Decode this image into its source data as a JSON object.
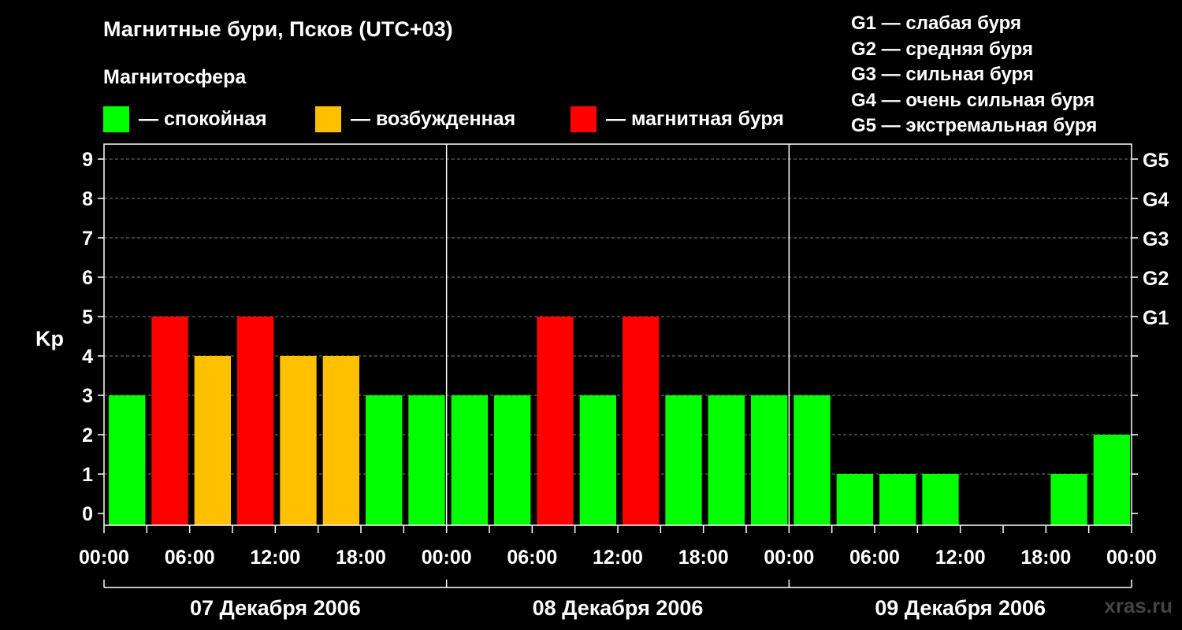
{
  "title": "Магнитные бури, Псков (UTC+03)",
  "subtitle": "Магнитосфера",
  "legend": [
    {
      "label": "— спокойная",
      "color": "#00ff00"
    },
    {
      "label": "— возбужденная",
      "color": "#ffc000"
    },
    {
      "label": "— магнитная буря",
      "color": "#ff0000"
    }
  ],
  "g_levels": [
    "G1 — слабая буря",
    "G2 — средняя буря",
    "G3 — сильная буря",
    "G4 — очень сильная буря",
    "G5 — экстремальная буря"
  ],
  "watermark": "xras.ru",
  "chart_data": {
    "type": "bar",
    "ylabel": "Kp",
    "ylim": [
      0,
      9
    ],
    "yticks": [
      "0",
      "1",
      "2",
      "3",
      "4",
      "5",
      "6",
      "7",
      "8",
      "9"
    ],
    "right_ticks": [
      {
        "kp": 5,
        "label": "G1"
      },
      {
        "kp": 6,
        "label": "G2"
      },
      {
        "kp": 7,
        "label": "G3"
      },
      {
        "kp": 8,
        "label": "G4"
      },
      {
        "kp": 9,
        "label": "G5"
      }
    ],
    "grid": "dashed horizontal",
    "xtick_labels": [
      "00:00",
      "06:00",
      "12:00",
      "18:00",
      "00:00",
      "06:00",
      "12:00",
      "18:00",
      "00:00",
      "06:00",
      "12:00",
      "18:00",
      "00:00"
    ],
    "days": [
      "07 Декабря 2006",
      "08 Декабря 2006",
      "09 Декабря 2006"
    ],
    "interval_hours": 3,
    "values": [
      3,
      5,
      4,
      5,
      4,
      4,
      3,
      3,
      3,
      3,
      5,
      3,
      5,
      3,
      3,
      3,
      3,
      1,
      1,
      1,
      null,
      null,
      1,
      2
    ],
    "colors": {
      "calm": "#00ff00",
      "excited": "#ffc000",
      "storm": "#ff0000"
    }
  }
}
